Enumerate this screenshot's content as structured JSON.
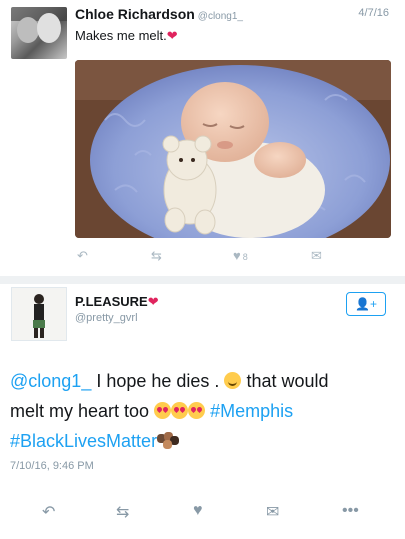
{
  "tweet1": {
    "display_name": "Chloe Richardson",
    "handle": "@clong1_",
    "date": "4/7/16",
    "text": "Makes me melt.",
    "text_emoji": "heart",
    "photo_description_icon": "baby-photo",
    "actions": {
      "reply_icon": "reply-icon",
      "retweet_icon": "retweet-icon",
      "like_icon": "heart-icon",
      "like_count": "8",
      "dm_icon": "dm-icon"
    }
  },
  "tweet2": {
    "display_name": "P.LEASURE",
    "name_emoji": "heart",
    "handle": "@pretty_gvrl",
    "follow_icon": "follow-user-icon",
    "follow_label": "+",
    "body": {
      "mention": "@clong1_",
      "text_a": "I hope he dies .",
      "text_b": "that would",
      "text_c": "melt my heart too",
      "hashtag1": "#Memphis",
      "hashtag2": "#BlackLivesMatter"
    },
    "timestamp": "7/10/16, 9:46 PM",
    "actions": {
      "reply_icon": "reply-icon",
      "retweet_icon": "retweet-icon",
      "like_icon": "heart-icon",
      "dm_icon": "dm-icon",
      "more_icon": "more-icon"
    }
  },
  "colors": {
    "link": "#1da1f2",
    "muted": "#8899a6",
    "heart": "#e0245e",
    "divider": "#eef1f3"
  }
}
